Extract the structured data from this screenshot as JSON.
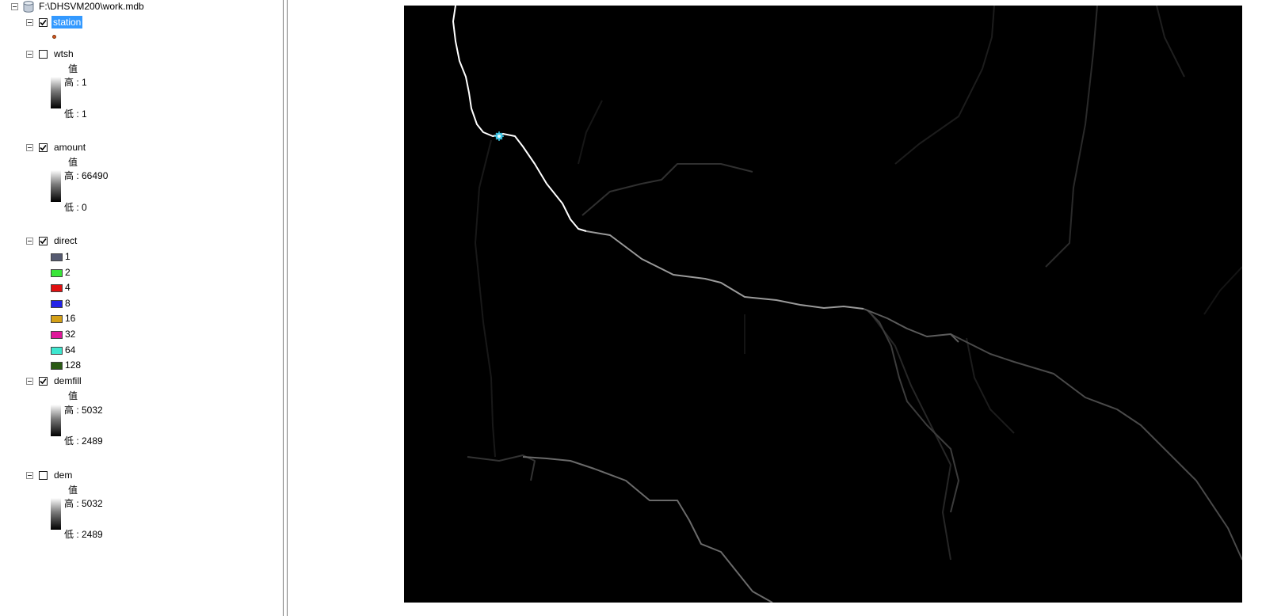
{
  "toc": {
    "root": {
      "label": "F:\\DHSVM200\\work.mdb",
      "icon": "database-icon"
    },
    "layers": {
      "station": {
        "name": "station",
        "checked": true,
        "selected": true,
        "symbol_color": "#d9541e"
      },
      "wtsh": {
        "name": "wtsh",
        "checked": false,
        "value_heading": "值",
        "high": "高 : 1",
        "low": "低 : 1"
      },
      "amount": {
        "name": "amount",
        "checked": true,
        "value_heading": "值",
        "high": "高 : 66490",
        "low": "低 : 0"
      },
      "direct": {
        "name": "direct",
        "checked": true,
        "classes": [
          {
            "label": "1",
            "color": "#555a70"
          },
          {
            "label": "2",
            "color": "#39e639"
          },
          {
            "label": "4",
            "color": "#e01010"
          },
          {
            "label": "8",
            "color": "#2222e8"
          },
          {
            "label": "16",
            "color": "#d4a017"
          },
          {
            "label": "32",
            "color": "#e0189a"
          },
          {
            "label": "64",
            "color": "#3ee6cf"
          },
          {
            "label": "128",
            "color": "#2a5a14"
          }
        ]
      },
      "demfill": {
        "name": "demfill",
        "checked": true,
        "value_heading": "值",
        "high": "高 : 5032",
        "low": "低 : 2489"
      },
      "dem": {
        "name": "dem",
        "checked": false,
        "value_heading": "值",
        "high": "高 : 5032",
        "low": "低 : 2489"
      }
    }
  },
  "map": {
    "background_color": "#000000",
    "station_marker_color": "#3ec8e8",
    "main_stream_color": "#ffffff"
  }
}
